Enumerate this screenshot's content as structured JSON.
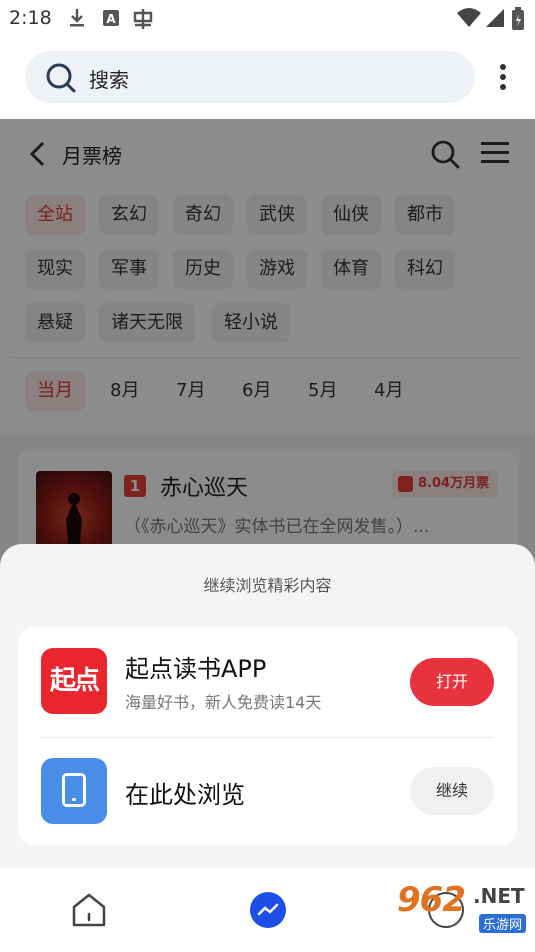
{
  "status_bar": {
    "time": "2:18"
  },
  "browser": {
    "search_placeholder": "搜索"
  },
  "page": {
    "title": "月票榜",
    "categories": [
      "全站",
      "玄幻",
      "奇幻",
      "武侠",
      "仙侠",
      "都市",
      "现实",
      "军事",
      "历史",
      "游戏",
      "体育",
      "科幻",
      "悬疑",
      "诸天无限",
      "轻小说"
    ],
    "active_category": "全站",
    "months": [
      "当月",
      "8月",
      "7月",
      "6月",
      "5月",
      "4月"
    ],
    "active_month": "当月",
    "book": {
      "rank": "1",
      "title": "赤心巡天",
      "tickets": "8.04万月票",
      "desc": "（《赤心巡天》实体书已在全网发售。）..."
    }
  },
  "sheet": {
    "title": "继续浏览精彩内容",
    "app_icon_text": "起点",
    "app_title": "起点读书APP",
    "app_subtitle": "海量好书，新人免费读14天",
    "open_label": "打开",
    "browse_title": "在此处浏览",
    "continue_label": "继续"
  },
  "watermark": {
    "num": "962",
    "net": ".NET",
    "sub": "乐游网"
  }
}
